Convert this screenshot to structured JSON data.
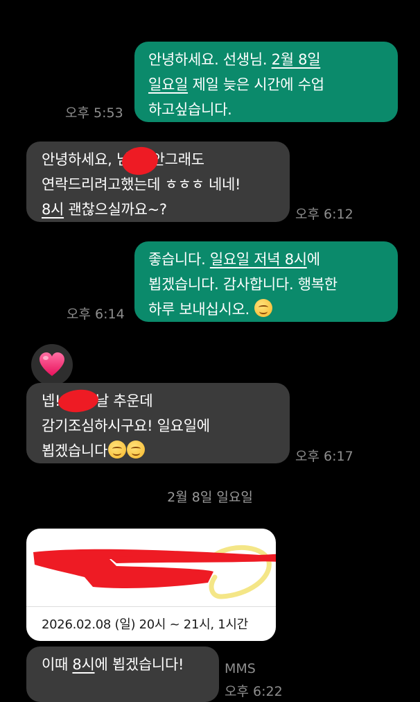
{
  "messages": [
    {
      "id": "m1",
      "dir": "out",
      "time": "오후 5:53",
      "parts": [
        {
          "t": "안녕하세요. 선생님. "
        },
        {
          "t": "2월 8일",
          "u": true
        },
        {
          "t": "\n"
        },
        {
          "t": "일요일",
          "u": true
        },
        {
          "t": " 제일 늦은 시간에 수업\n하고싶습니다."
        }
      ]
    },
    {
      "id": "m2",
      "dir": "in",
      "time": "오후 6:12",
      "parts": [
        {
          "t": "안녕하세요,      님~! 안그래도\n연락드리려고했는데 ㅎㅎㅎ 네네!\n"
        },
        {
          "t": "8시",
          "u": true
        },
        {
          "t": " 괜찮으실까요~?"
        }
      ]
    },
    {
      "id": "m3",
      "dir": "out",
      "time": "오후 6:14",
      "parts": [
        {
          "t": "좋습니다. "
        },
        {
          "t": "일요일 저녁 8시",
          "u": true
        },
        {
          "t": "에\n뵙겠습니다. 감사합니다. 행복한\n하루 보내십시오. "
        },
        {
          "emoji": "smiling-face"
        }
      ]
    },
    {
      "id": "m4",
      "dir": "in",
      "time": "오후 6:17",
      "parts": [
        {
          "t": "넵!       님도 날 추운데\n감기조심하시구요! 일요일에\n뵙겠습니다"
        },
        {
          "emoji": "relieved-face"
        },
        {
          "emoji": "relieved-face"
        }
      ]
    },
    {
      "id": "m5",
      "dir": "in",
      "time": "오후 6:22",
      "label": "MMS",
      "parts": [
        {
          "t": "이때 "
        },
        {
          "t": "8시",
          "u": true
        },
        {
          "t": "에 뵙겠습니다!"
        }
      ]
    }
  ],
  "reaction": {
    "icon": "heart-icon"
  },
  "date_separator": "2월 8일 일요일",
  "image_card": {
    "date_text": "2026.02.08 (일) 20시 ~ 21시,  1시간"
  },
  "colors": {
    "outgoing": "#0b8a6b",
    "incoming": "#3b3b3b",
    "background": "#000000",
    "redaction": "#ee1b24"
  }
}
